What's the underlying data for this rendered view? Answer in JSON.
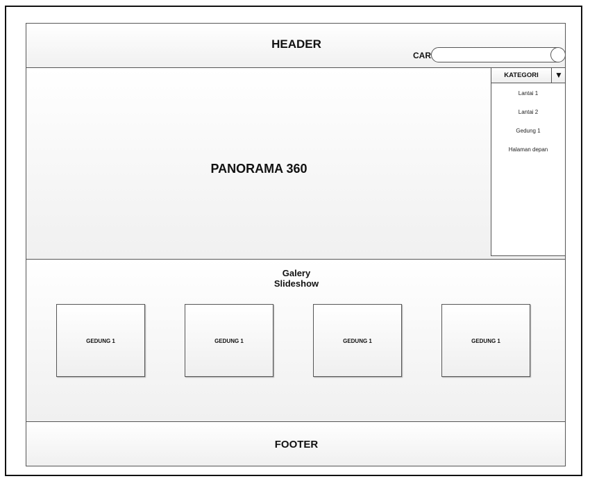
{
  "header": {
    "title": "HEADER",
    "search_label": "CARI",
    "search_placeholder": "",
    "search_value": ""
  },
  "panorama": {
    "title": "PANORAMA 360"
  },
  "kategori": {
    "label": "KATEGORI",
    "arrow": "▼",
    "items": [
      "Lantai 1",
      "Lantai 2",
      "Gedung 1",
      "Halaman depan"
    ]
  },
  "gallery": {
    "title_line1": "Galery",
    "title_line2": "Slideshow",
    "thumbs": [
      "GEDUNG 1",
      "GEDUNG 1",
      "GEDUNG 1",
      "GEDUNG 1"
    ]
  },
  "footer": {
    "title": "FOOTER"
  }
}
